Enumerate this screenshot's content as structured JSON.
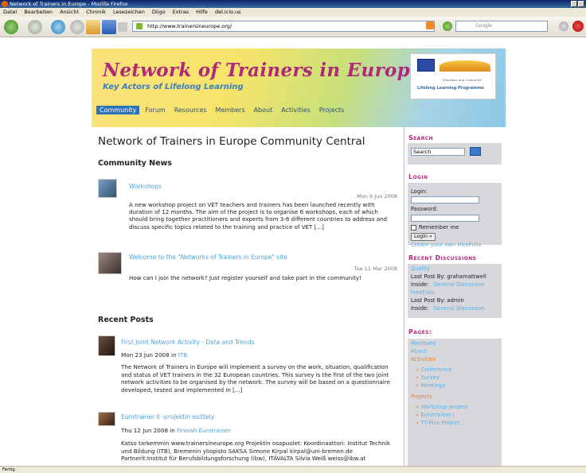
{
  "browser": {
    "window_title": "Network of Trainers in Europe - Mozilla Firefox",
    "menu": [
      "Datei",
      "Bearbeiten",
      "Ansicht",
      "Chronik",
      "Lesezeichen",
      "Diigo",
      "Extras",
      "Hilfe",
      "del.icio.us"
    ],
    "url": "http://www.trainersineurope.org/",
    "search_placeholder": "Google",
    "status": "Fertig"
  },
  "header": {
    "title": "Network of Trainers in Europe",
    "subtitle": "Key Actors of Lifelong Learning",
    "logo_line1": "Education and Culture DG",
    "logo_line2": "Lifelong Learning Programme"
  },
  "nav": [
    {
      "label": "Community",
      "active": true
    },
    {
      "label": "Forum"
    },
    {
      "label": "Resources"
    },
    {
      "label": "Members"
    },
    {
      "label": "About"
    },
    {
      "label": "Activities"
    },
    {
      "label": "Projects"
    }
  ],
  "main": {
    "page_title": "Network of Trainers in Europe Community Central",
    "community_news_heading": "Community News",
    "news": [
      {
        "title": "Workshops",
        "date": "Mon 9 Jun 2008",
        "text": "A new workshop project on VET teachers and trainers has been launched recently with duration of 12 months. The aim of the project is to organise 6 workshops, each of which should bring together practitioners and experts from 3-6 different countries to address and discuss specific topics related to the training and practice of VET [...]"
      },
      {
        "title": "Welcome to the \"Networks of Trainers in Europe\" site",
        "date": "Tue 11 Mar 2008",
        "text": "How can I join the network? Just register yourself and take part in the community!"
      }
    ],
    "recent_posts_heading": "Recent Posts",
    "posts": [
      {
        "title": "First Joint Network Activity - Data and Trends",
        "date": "Mon 23 Jun 2008 in",
        "category": "ITB",
        "text": "The Network of Trainers in Europe will implement a survey on the work, situation, qualification and status of VET trainers in the 32 European countries. This survey is the first of the two joint network activities to be organised by the network. The survey will be based on a questionnaire developed, tested and implemented in [...]"
      },
      {
        "title": "Eurotrainer II -projektin esittely",
        "date": "Thu 12 Jun 2008 in",
        "category": "Finnish Eurotrainer",
        "text": "Katso tarkemmin www.trainersineurope.org Projektin osapuolet: Koordinaattori: Institut Technik und Bildung (ITB), Bremenin yliopisto SAKSA Simone Kirpal kirpal@uni-bremen.de Partnerit:Institut für Berufsbildungsforschung (ibw), ITÄVALTA Silvia Weiß weiss@ibw.at"
      }
    ]
  },
  "sidebar": {
    "search_heading": "Search",
    "search_value": "Search",
    "login_heading": "Login",
    "login_label": "Login:",
    "password_label": "Password:",
    "remember_label": "Remember me",
    "login_button": "Login »",
    "freefolio_link": "Create your own FreeFolio",
    "discussions_heading": "Recent Discussions",
    "discussions": [
      {
        "title": "Quality",
        "last_post": "Last Post By: grahamattwell",
        "inside": "Inside:",
        "forum": "General Discussion"
      },
      {
        "title": "FreeFolio",
        "last_post": "Last Post By: admin",
        "inside": "Inside:",
        "forum": "General Discussion"
      }
    ],
    "pages_heading": "Pages:",
    "pages": {
      "members": "Members",
      "about": "About",
      "activities": "Activities",
      "activities_sub": [
        "Conference",
        "Survey",
        "Meetings"
      ],
      "projects": "Projects",
      "projects_sub": [
        "Workshop project",
        "Eurotrainer I",
        "TT-Plus Project"
      ]
    }
  }
}
